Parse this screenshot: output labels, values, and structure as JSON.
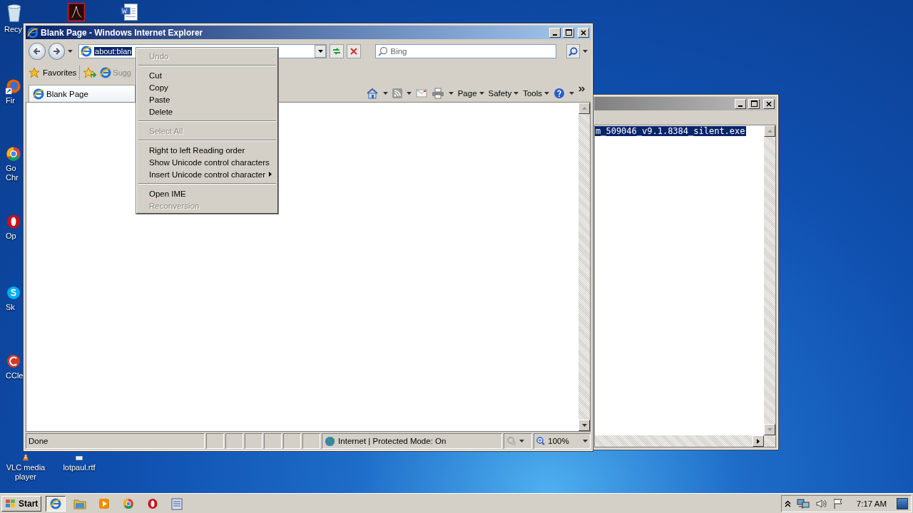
{
  "desktop_icons": [
    {
      "kind": "recycle-bin",
      "lines": [
        "Recy"
      ]
    },
    {
      "kind": "pdf"
    },
    {
      "kind": "word"
    },
    {
      "kind": "firefox",
      "lines": [
        "Fir"
      ]
    },
    {
      "kind": "chrome",
      "lines": [
        "Go",
        "Chr"
      ]
    },
    {
      "kind": "opera",
      "lines": [
        "Op"
      ]
    },
    {
      "kind": "skype",
      "lines": [
        "Sk"
      ]
    },
    {
      "kind": "ccleaner",
      "lines": [
        "CCle"
      ]
    },
    {
      "kind": "vlc",
      "lines": [
        "VLC media",
        "player"
      ]
    },
    {
      "kind": "document",
      "lines": [
        "lotpaul.rtf"
      ]
    }
  ],
  "background_window": {
    "selected_line": "m_509046_v9.1.8384_silent.exe"
  },
  "browser": {
    "title": "Blank Page - Windows Internet Explorer",
    "address": "about:blan",
    "search": {
      "placeholder": "Bing"
    },
    "favorites_bar": {
      "favorites": "Favorites",
      "suggested": "Sugg"
    },
    "tabs": [
      {
        "label": "Blank Page",
        "selected": true
      }
    ],
    "command_bar": [
      {
        "kind": "home"
      },
      {
        "kind": "feeds"
      },
      {
        "kind": "mail"
      },
      {
        "kind": "print"
      },
      {
        "kind": "menu",
        "label": "Page"
      },
      {
        "kind": "menu",
        "label": "Safety"
      },
      {
        "kind": "menu",
        "label": "Tools"
      },
      {
        "kind": "help"
      }
    ],
    "status_bar": {
      "status": "Done",
      "zone": "Internet | Protected Mode: On",
      "zoom": "100%"
    }
  },
  "context_menu": [
    {
      "kind": "item",
      "label": "Undo",
      "disabled": true
    },
    {
      "kind": "separator"
    },
    {
      "kind": "item",
      "label": "Cut",
      "disabled": false
    },
    {
      "kind": "item",
      "label": "Copy",
      "disabled": false
    },
    {
      "kind": "item",
      "label": "Paste",
      "disabled": false
    },
    {
      "kind": "item",
      "label": "Delete",
      "disabled": false
    },
    {
      "kind": "separator"
    },
    {
      "kind": "item",
      "label": "Select All",
      "disabled": true
    },
    {
      "kind": "separator"
    },
    {
      "kind": "item",
      "label": "Right to left Reading order",
      "disabled": false
    },
    {
      "kind": "item",
      "label": "Show Unicode control characters",
      "disabled": false
    },
    {
      "kind": "submenu",
      "label": "Insert Unicode control character",
      "disabled": false
    },
    {
      "kind": "separator"
    },
    {
      "kind": "item",
      "label": "Open IME",
      "disabled": false
    },
    {
      "kind": "item",
      "label": "Reconversion",
      "disabled": true
    }
  ],
  "taskbar": {
    "start": "Start",
    "apps": [
      {
        "kind": "ie",
        "selected": true
      },
      {
        "kind": "folder",
        "selected": false
      },
      {
        "kind": "media",
        "selected": false
      },
      {
        "kind": "chrome",
        "selected": false
      },
      {
        "kind": "opera",
        "selected": false
      },
      {
        "kind": "notepad",
        "selected": false
      }
    ],
    "tray": [
      {
        "kind": "chevron"
      },
      {
        "kind": "network"
      },
      {
        "kind": "volume"
      },
      {
        "kind": "flag"
      }
    ],
    "clock": "7:17 AM"
  }
}
